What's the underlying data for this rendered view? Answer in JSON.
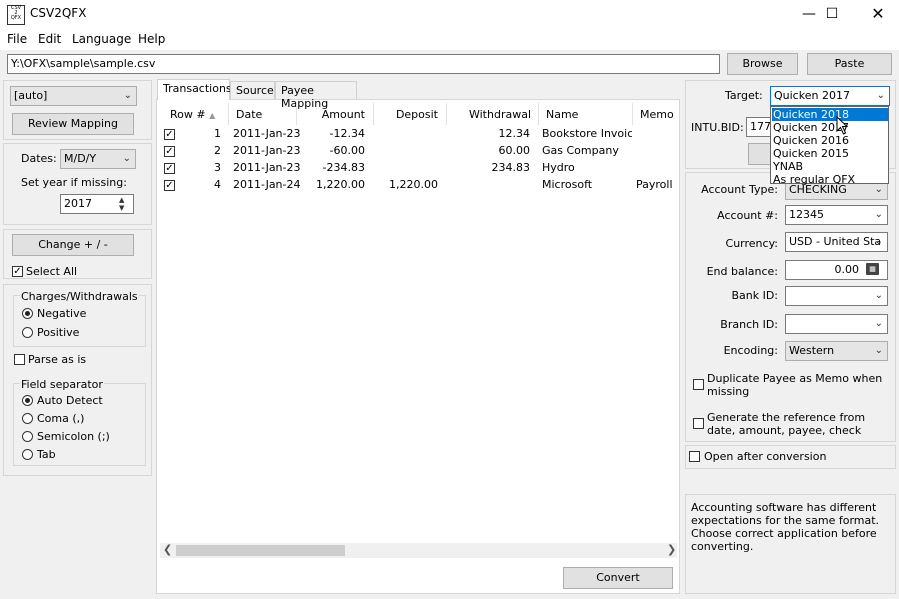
{
  "window": {
    "title": "CSV2QFX",
    "app_icon_text": "CSV\n2\nQFX"
  },
  "menu": [
    "File",
    "Edit",
    "Language",
    "Help"
  ],
  "path": {
    "value": "Y:\\OFX\\sample\\sample.csv",
    "browse": "Browse",
    "paste": "Paste"
  },
  "left": {
    "profile": "[auto]",
    "review_mapping": "Review Mapping",
    "dates_label": "Dates:",
    "dates_value": "M/D/Y",
    "set_year_label": "Set year if missing:",
    "year_value": "2017",
    "change_sign": "Change + / -",
    "select_all": "Select All",
    "charges_title": "Charges/Withdrawals",
    "negative": "Negative",
    "positive": "Positive",
    "parse_as_is": "Parse as is",
    "field_sep_title": "Field separator",
    "auto_detect": "Auto Detect",
    "coma": "Coma (,)",
    "semicolon": "Semicolon (;)",
    "tab": "Tab"
  },
  "tabs": [
    "Transactions",
    "Source",
    "Payee Mapping"
  ],
  "table": {
    "headers": [
      "Row #",
      "Date",
      "Amount",
      "Deposit",
      "Withdrawal",
      "Name",
      "Memo"
    ],
    "rows": [
      [
        "1",
        "2011-Jan-23",
        "-12.34",
        "",
        "12.34",
        "Bookstore Invoice",
        ""
      ],
      [
        "2",
        "2011-Jan-23",
        "-60.00",
        "",
        "60.00",
        "Gas Company",
        ""
      ],
      [
        "3",
        "2011-Jan-23",
        "-234.83",
        "",
        "234.83",
        "Hydro",
        ""
      ],
      [
        "4",
        "2011-Jan-24",
        "1,220.00",
        "1,220.00",
        "",
        "Microsoft",
        "Payroll"
      ]
    ]
  },
  "convert": "Convert",
  "right": {
    "target_label": "Target:",
    "target_value": "Quicken 2017",
    "intu_label": "INTU.BID:",
    "intu_value": "177",
    "account_type_label": "Account Type:",
    "account_type_value": "CHECKING",
    "account_num_label": "Account #:",
    "account_num_value": "12345",
    "currency_label": "Currency:",
    "currency_value": "USD - United Sta",
    "end_balance_label": "End balance:",
    "end_balance_value": "0.00",
    "bank_id_label": "Bank ID:",
    "branch_id_label": "Branch ID:",
    "encoding_label": "Encoding:",
    "encoding_value": "Western",
    "dup_payee": "Duplicate Payee as Memo when missing",
    "gen_ref": "Generate the reference from date, amount, payee, check",
    "open_after": "Open after conversion",
    "info": "Accounting software has different expectations for the same format. Choose correct application before converting.",
    "target_options": [
      "Quicken 2018",
      "Quicken 2017",
      "Quicken 2016",
      "Quicken 2015",
      "YNAB",
      "As regular QFX"
    ]
  }
}
